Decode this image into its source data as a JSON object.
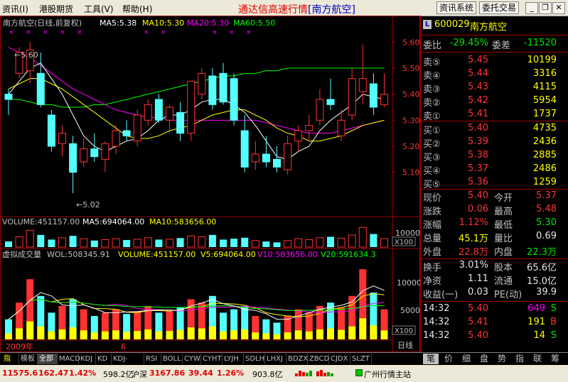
{
  "menu": {
    "items": [
      "资讯(I)",
      "港股期货",
      "工具(V)",
      "帮助(H)"
    ],
    "app_title": "通达信高速行情",
    "app_subtitle": "[南方航空]",
    "buttons": [
      "资讯系统",
      "委托交易"
    ]
  },
  "chart": {
    "header": "南方航空(日线,前复权)",
    "ma": [
      {
        "label": "MA5:5.38",
        "color": "#ffffff"
      },
      {
        "label": "MA10:5.30",
        "color": "#ffff00"
      },
      {
        "label": "MA20:5.30",
        "color": "#ff00ff"
      },
      {
        "label": "MA60:5.50",
        "color": "#00ff00"
      }
    ],
    "high_label": "5.60",
    "low_label": "5.02",
    "price_ticks": [
      "5.60",
      "5.50",
      "5.40",
      "5.30",
      "5.20",
      "5.10"
    ],
    "volume_header": [
      "VOLUME:451157.00",
      "MA5:694064.00",
      "MA10:583656.00"
    ],
    "volume_tick": "10000",
    "volume_unit": "X100",
    "virtual_header": [
      "虚拟成交量",
      "WOL:508345.91",
      "VOLUME:451157.00",
      "V5:694064.00",
      "V10:583656.00",
      "V20:591634.3"
    ],
    "virtual_ticks": [
      "10000",
      "5000"
    ],
    "virtual_unit": "X100",
    "date_labels": [
      "2009年",
      "6"
    ],
    "period_label": "日线"
  },
  "chart_data": {
    "type": "candlestick",
    "ylim": [
      5.02,
      5.62
    ],
    "candles": [
      {
        "o": 5.4,
        "h": 5.42,
        "l": 5.32,
        "c": 5.38
      },
      {
        "o": 5.48,
        "h": 5.58,
        "l": 5.46,
        "c": 5.56
      },
      {
        "o": 5.49,
        "h": 5.6,
        "l": 5.44,
        "c": 5.57
      },
      {
        "o": 5.48,
        "h": 5.56,
        "l": 5.35,
        "c": 5.36
      },
      {
        "o": 5.32,
        "h": 5.34,
        "l": 5.18,
        "c": 5.2
      },
      {
        "o": 5.21,
        "h": 5.28,
        "l": 5.16,
        "c": 5.25
      },
      {
        "o": 5.21,
        "h": 5.24,
        "l": 5.02,
        "c": 5.1
      },
      {
        "o": 5.14,
        "h": 5.23,
        "l": 5.12,
        "c": 5.19
      },
      {
        "o": 5.19,
        "h": 5.25,
        "l": 5.14,
        "c": 5.16
      },
      {
        "o": 5.15,
        "h": 5.22,
        "l": 5.1,
        "c": 5.21
      },
      {
        "o": 5.2,
        "h": 5.28,
        "l": 5.17,
        "c": 5.26
      },
      {
        "o": 5.26,
        "h": 5.3,
        "l": 5.22,
        "c": 5.24
      },
      {
        "o": 5.22,
        "h": 5.34,
        "l": 5.2,
        "c": 5.32
      },
      {
        "o": 5.3,
        "h": 5.38,
        "l": 5.28,
        "c": 5.36
      },
      {
        "o": 5.38,
        "h": 5.4,
        "l": 5.29,
        "c": 5.3
      },
      {
        "o": 5.3,
        "h": 5.36,
        "l": 5.25,
        "c": 5.35
      },
      {
        "o": 5.33,
        "h": 5.37,
        "l": 5.22,
        "c": 5.25
      },
      {
        "o": 5.25,
        "h": 5.45,
        "l": 5.22,
        "c": 5.45
      },
      {
        "o": 5.4,
        "h": 5.5,
        "l": 5.38,
        "c": 5.48
      },
      {
        "o": 5.47,
        "h": 5.5,
        "l": 5.34,
        "c": 5.36
      },
      {
        "o": 5.48,
        "h": 5.52,
        "l": 5.36,
        "c": 5.37
      },
      {
        "o": 5.46,
        "h": 5.48,
        "l": 5.28,
        "c": 5.3
      },
      {
        "o": 5.26,
        "h": 5.32,
        "l": 5.1,
        "c": 5.12
      },
      {
        "o": 5.14,
        "h": 5.22,
        "l": 5.11,
        "c": 5.17
      },
      {
        "o": 5.17,
        "h": 5.24,
        "l": 5.12,
        "c": 5.14
      },
      {
        "o": 5.15,
        "h": 5.2,
        "l": 5.1,
        "c": 5.12
      },
      {
        "o": 5.11,
        "h": 5.24,
        "l": 5.09,
        "c": 5.21
      },
      {
        "o": 5.22,
        "h": 5.28,
        "l": 5.18,
        "c": 5.26
      },
      {
        "o": 5.26,
        "h": 5.32,
        "l": 5.22,
        "c": 5.28
      },
      {
        "o": 5.3,
        "h": 5.42,
        "l": 5.28,
        "c": 5.38
      },
      {
        "o": 5.38,
        "h": 5.46,
        "l": 5.34,
        "c": 5.36
      },
      {
        "o": 5.24,
        "h": 5.34,
        "l": 5.22,
        "c": 5.3
      },
      {
        "o": 5.32,
        "h": 5.5,
        "l": 5.3,
        "c": 5.46
      },
      {
        "o": 5.41,
        "h": 5.59,
        "l": 5.36,
        "c": 5.46
      },
      {
        "o": 5.44,
        "h": 5.48,
        "l": 5.32,
        "c": 5.35
      },
      {
        "o": 5.36,
        "h": 5.48,
        "l": 5.35,
        "c": 5.4
      }
    ],
    "ma5": [
      5.4,
      5.45,
      5.5,
      5.52,
      5.46,
      5.4,
      5.32,
      5.24,
      5.2,
      5.18,
      5.2,
      5.22,
      5.23,
      5.26,
      5.3,
      5.32,
      5.32,
      5.34,
      5.37,
      5.38,
      5.38,
      5.36,
      5.33,
      5.28,
      5.22,
      5.16,
      5.15,
      5.18,
      5.2,
      5.26,
      5.3,
      5.33,
      5.36,
      5.4,
      5.39,
      5.38
    ],
    "ma10": [
      5.42,
      5.44,
      5.46,
      5.46,
      5.44,
      5.42,
      5.39,
      5.36,
      5.33,
      5.3,
      5.27,
      5.24,
      5.23,
      5.23,
      5.24,
      5.26,
      5.27,
      5.28,
      5.3,
      5.32,
      5.33,
      5.34,
      5.34,
      5.32,
      5.3,
      5.27,
      5.25,
      5.24,
      5.22,
      5.22,
      5.23,
      5.24,
      5.26,
      5.28,
      5.29,
      5.3
    ],
    "ma20": [
      5.58,
      5.56,
      5.54,
      5.51,
      5.48,
      5.45,
      5.42,
      5.4,
      5.38,
      5.36,
      5.34,
      5.33,
      5.32,
      5.31,
      5.31,
      5.3,
      5.3,
      5.3,
      5.3,
      5.3,
      5.3,
      5.3,
      5.3,
      5.3,
      5.29,
      5.28,
      5.27,
      5.26,
      5.25,
      5.25,
      5.25,
      5.26,
      5.27,
      5.28,
      5.29,
      5.3
    ],
    "ma60": [
      5.38,
      5.38,
      5.37,
      5.36,
      5.36,
      5.35,
      5.35,
      5.35,
      5.36,
      5.36,
      5.37,
      5.38,
      5.39,
      5.4,
      5.41,
      5.42,
      5.43,
      5.44,
      5.45,
      5.46,
      5.47,
      5.47,
      5.48,
      5.48,
      5.49,
      5.49,
      5.5,
      5.5,
      5.5,
      5.5,
      5.5,
      5.5,
      5.5,
      5.5,
      5.5,
      5.5
    ],
    "volume": [
      3000,
      5500,
      9000,
      6500,
      4000,
      5000,
      6000,
      4500,
      3500,
      4000,
      4500,
      3800,
      4200,
      5000,
      4000,
      4200,
      4800,
      6000,
      5500,
      6500,
      4000,
      4500,
      5000,
      3500,
      3000,
      2500,
      3500,
      4500,
      4000,
      5000,
      5500,
      4800,
      6500,
      10500,
      7000,
      4500
    ]
  },
  "quote": {
    "code": "600029",
    "name": "南方航空",
    "weibi_label": "委比",
    "weibi": "-29.45%",
    "weicha_label": "委差",
    "weicha": "-11520",
    "sells": [
      {
        "label": "卖⑤",
        "price": "5.45",
        "vol": "10199"
      },
      {
        "label": "卖④",
        "price": "5.44",
        "vol": "3316"
      },
      {
        "label": "卖③",
        "price": "5.43",
        "vol": "4115"
      },
      {
        "label": "卖②",
        "price": "5.42",
        "vol": "5954"
      },
      {
        "label": "卖①",
        "price": "5.41",
        "vol": "1737"
      }
    ],
    "buys": [
      {
        "label": "买①",
        "price": "5.40",
        "vol": "4735"
      },
      {
        "label": "买②",
        "price": "5.39",
        "vol": "2436"
      },
      {
        "label": "买③",
        "price": "5.38",
        "vol": "2885"
      },
      {
        "label": "买④",
        "price": "5.37",
        "vol": "2486"
      },
      {
        "label": "买⑤",
        "price": "5.36",
        "vol": "1259"
      }
    ],
    "stats": [
      {
        "l1": "现价",
        "v1": "5.40",
        "c1": "red",
        "l2": "今开",
        "v2": "5.37",
        "c2": "red"
      },
      {
        "l1": "涨跌",
        "v1": "0.06",
        "c1": "red",
        "l2": "最高",
        "v2": "5.48",
        "c2": "red"
      },
      {
        "l1": "涨幅",
        "v1": "1.12%",
        "c1": "red",
        "l2": "最低",
        "v2": "5.30",
        "c2": "green"
      },
      {
        "l1": "总量",
        "v1": "45.1万",
        "c1": "yellow",
        "l2": "量比",
        "v2": "0.69",
        "c2": "white"
      },
      {
        "l1": "外盘",
        "v1": "22.8万",
        "c1": "red",
        "l2": "内盘",
        "v2": "22.3万",
        "c2": "green"
      }
    ],
    "fin": [
      {
        "l1": "换手",
        "v1": "3.01%",
        "l2": "股本",
        "v2": "65.6亿"
      },
      {
        "l1": "净资",
        "v1": "1.11",
        "l2": "流通",
        "v2": "15.0亿"
      },
      {
        "l1": "收益(一)",
        "v1": "0.03",
        "l2": "PE(动)",
        "v2": "39.9"
      }
    ],
    "ticks": [
      {
        "time": "14:32",
        "price": "5.40",
        "vol": "649",
        "side": "S",
        "pc": "red",
        "vc": "mag",
        "sc": "green"
      },
      {
        "time": "14:32",
        "price": "5.41",
        "vol": "191",
        "side": "B",
        "pc": "red",
        "vc": "yellow",
        "sc": "red"
      },
      {
        "time": "14:32",
        "price": "5.40",
        "vol": "14",
        "side": "S",
        "pc": "red",
        "vc": "yellow",
        "sc": "green"
      }
    ]
  },
  "tabs": [
    "指标",
    "模板",
    "全部",
    "MACD",
    "KDJ",
    "KD",
    "KDJ-TDX",
    "RSI",
    "BOLL",
    "CYW",
    "CYHT",
    "LYJH",
    "SDLH",
    "LHXJ",
    "BDZX",
    "ZBCD",
    "CJDX",
    "SLZT"
  ],
  "side_tabs": [
    "笔",
    "价",
    "细",
    "盘",
    "势",
    "指",
    "联",
    "筹"
  ],
  "status": {
    "sh_index": "11575.6",
    "sh_change": "162.47",
    "sh_pct": "1.42%",
    "sh_amount": "598.2亿",
    "hs_label": "沪深",
    "hs_index": "3167.86",
    "hs_change": "39.44",
    "hs_pct": "1.26%",
    "hs_amount": "903.8亿",
    "server": "广州行情主站"
  }
}
